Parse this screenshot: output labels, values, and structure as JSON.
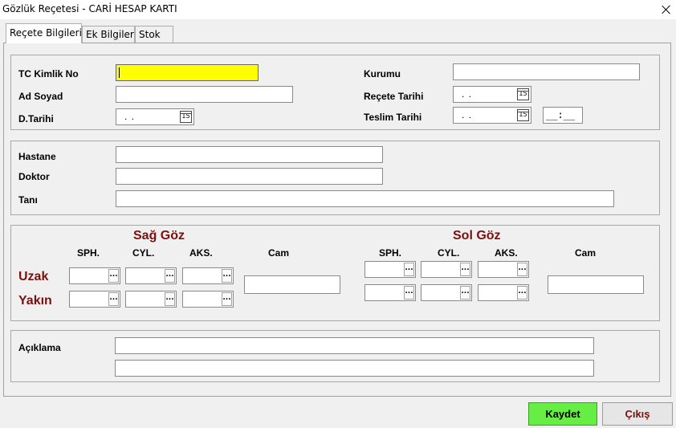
{
  "window": {
    "title": "Gözlük Reçetesi - CARİ HESAP KARTI"
  },
  "tabs": [
    {
      "label": "Reçete Bilgileri"
    },
    {
      "label": "Ek Bilgiler"
    },
    {
      "label": "Stok"
    }
  ],
  "patient": {
    "tc_label": "TC Kimlik No",
    "tc_value": "",
    "ad_soyad_label": "Ad Soyad",
    "ad_soyad_value": "",
    "dtarihi_label": "D.Tarihi",
    "dtarihi_value": ". .",
    "kurumu_label": "Kurumu",
    "kurumu_value": "",
    "recete_tarihi_label": "Reçete Tarihi",
    "recete_tarihi_value": ". .",
    "teslim_tarihi_label": "Teslim Tarihi",
    "teslim_tarihi_value": ". .",
    "teslim_saat_value": "__:__",
    "calendar_glyph": "15"
  },
  "hospital": {
    "hastane_label": "Hastane",
    "doktor_label": "Doktor",
    "tani_label": "Tanı"
  },
  "prescription": {
    "sag_goz_title": "Sağ Göz",
    "sol_goz_title": "Sol Göz",
    "sph": "SPH.",
    "cyl": "CYL.",
    "aks": "AKS.",
    "cam": "Cam",
    "uzak": "Uzak",
    "yakin": "Yakın",
    "dots": "..."
  },
  "aciklama": {
    "label": "Açıklama"
  },
  "buttons": {
    "save": "Kaydet",
    "exit": "Çıkış"
  },
  "colors": {
    "accent_red": "#7b1010",
    "highlight_yellow": "#ffff00",
    "save_green": "#66ee44"
  }
}
